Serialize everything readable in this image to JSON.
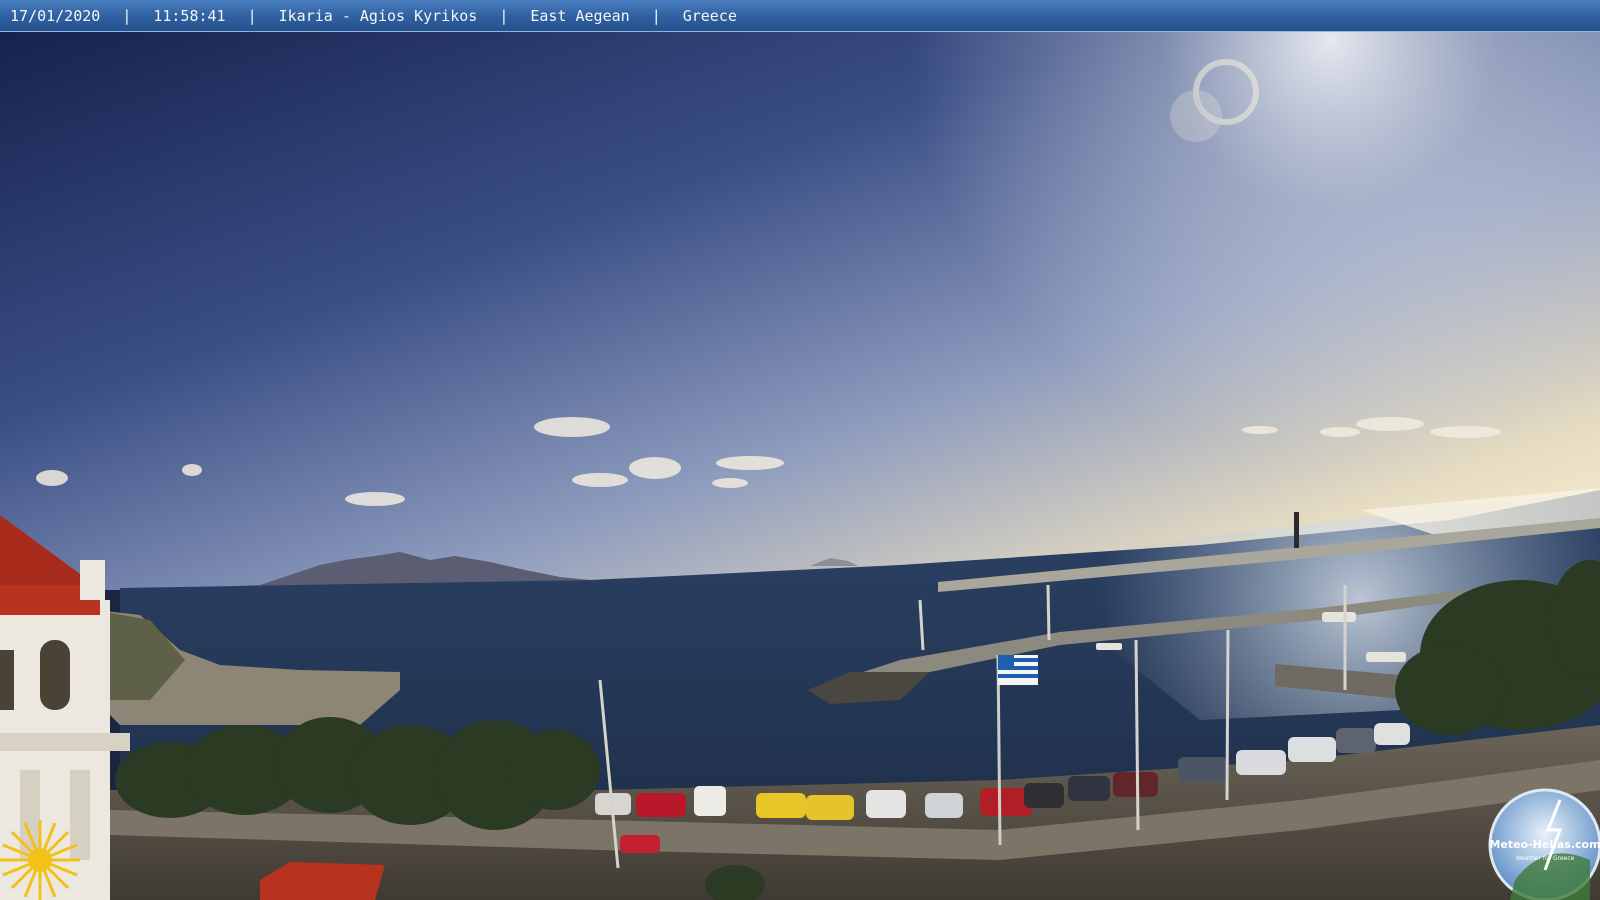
{
  "overlay": {
    "date": "17/01/2020",
    "time": "11:58:41",
    "location": "Ikaria - Agios Kyrikos",
    "region": "East Aegean",
    "country": "Greece",
    "separator": "|"
  },
  "watermark": {
    "brand": "Meteo-Hellas.com",
    "tagline": "Weather for Greece"
  },
  "colors": {
    "bar": "#2f5f9f",
    "sky_top": "#1b2a5c",
    "sky_horizon": "#f0e2bf",
    "sea": "#243a5c"
  }
}
